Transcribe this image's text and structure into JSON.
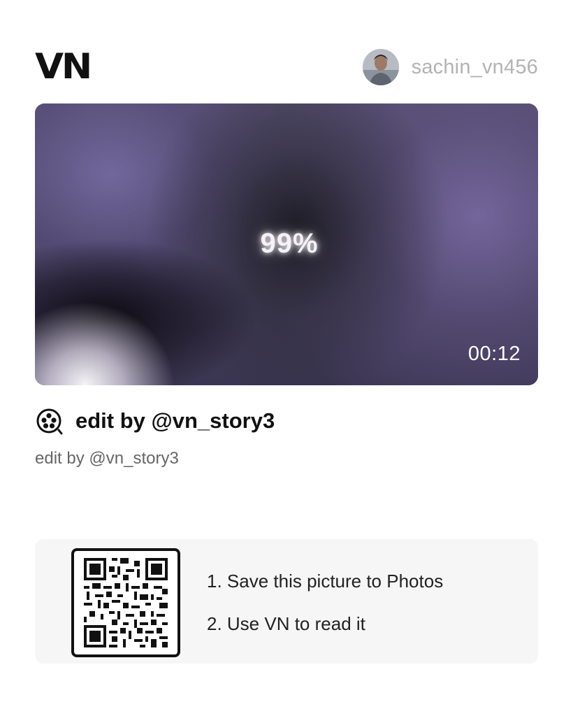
{
  "header": {
    "logo_text": "VN",
    "username": "sachin_vn456",
    "avatar_icon": "user-avatar"
  },
  "video": {
    "overlay_text": "99%",
    "duration": "00:12"
  },
  "project": {
    "icon": "film-reel-icon",
    "title": "edit by @vn_story3",
    "description": "edit by @vn_story3"
  },
  "qr_card": {
    "icon": "qr-code",
    "steps": [
      "1. Save this picture to Photos",
      "2. Use VN to read it"
    ]
  },
  "colors": {
    "text_primary": "#111111",
    "text_muted": "#666666",
    "username": "#b3b3b3",
    "card_bg": "#f6f6f7"
  }
}
